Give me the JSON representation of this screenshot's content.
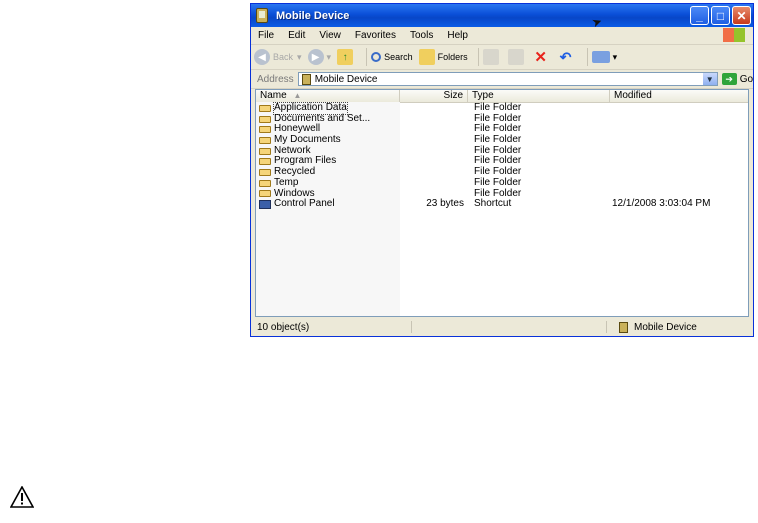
{
  "window": {
    "title": "Mobile Device",
    "buttons": {
      "minimize": "_",
      "maximize": "□",
      "close": "✕"
    }
  },
  "menu": [
    "File",
    "Edit",
    "View",
    "Favorites",
    "Tools",
    "Help"
  ],
  "toolbar": {
    "back_label": "Back",
    "search_label": "Search",
    "folders_label": "Folders"
  },
  "address": {
    "label": "Address",
    "value": "Mobile Device",
    "go_label": "Go"
  },
  "columns": {
    "name": "Name",
    "size": "Size",
    "type": "Type",
    "modified": "Modified"
  },
  "files": [
    {
      "name": "Application Data",
      "size": "",
      "type": "File Folder",
      "modified": "",
      "icon": "folder-icon"
    },
    {
      "name": "Documents and Set...",
      "size": "",
      "type": "File Folder",
      "modified": "",
      "icon": "folder-icon"
    },
    {
      "name": "Honeywell",
      "size": "",
      "type": "File Folder",
      "modified": "",
      "icon": "folder-icon"
    },
    {
      "name": "My Documents",
      "size": "",
      "type": "File Folder",
      "modified": "",
      "icon": "folder-icon"
    },
    {
      "name": "Network",
      "size": "",
      "type": "File Folder",
      "modified": "",
      "icon": "folder-icon"
    },
    {
      "name": "Program Files",
      "size": "",
      "type": "File Folder",
      "modified": "",
      "icon": "folder-icon"
    },
    {
      "name": "Recycled",
      "size": "",
      "type": "File Folder",
      "modified": "",
      "icon": "folder-icon"
    },
    {
      "name": "Temp",
      "size": "",
      "type": "File Folder",
      "modified": "",
      "icon": "folder-icon"
    },
    {
      "name": "Windows",
      "size": "",
      "type": "File Folder",
      "modified": "",
      "icon": "folder-icon"
    },
    {
      "name": "Control Panel",
      "size": "23 bytes",
      "type": "Shortcut",
      "modified": "12/1/2008  3:03:04 PM",
      "icon": "shortcut-icon"
    }
  ],
  "status": {
    "count": "10 object(s)",
    "location": "Mobile Device"
  },
  "colors": {
    "titlebar": "#0a4fd8",
    "window_bg": "#ece9d8",
    "folder": "#f5d57a",
    "go_arrow": "#2fa43a",
    "delete_icon": "#e8231b"
  }
}
